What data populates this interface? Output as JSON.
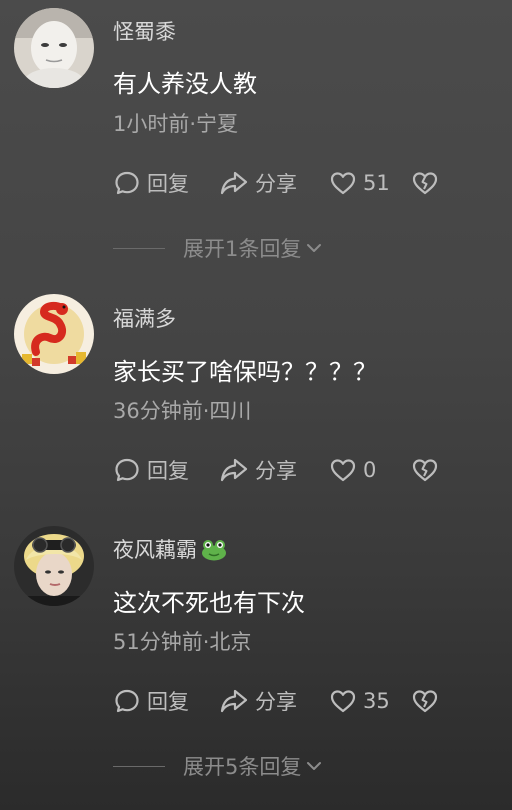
{
  "comments": [
    {
      "username": "怪蜀黍",
      "text": "有人养没人教",
      "meta": "1小时前·宁夏",
      "reply_label": "回复",
      "share_label": "分享",
      "likes": "51",
      "expand_label": "展开1条回复"
    },
    {
      "username": "福满多",
      "text": "家长买了啥保吗？？？？",
      "meta": "36分钟前·四川",
      "reply_label": "回复",
      "share_label": "分享",
      "likes": "0"
    },
    {
      "username": "夜风藕霸",
      "text": "这次不死也有下次",
      "meta": "51分钟前·北京",
      "reply_label": "回复",
      "share_label": "分享",
      "likes": "35",
      "expand_label": "展开5条回复"
    }
  ],
  "icons": {
    "reply": "chat-bubble-icon",
    "share": "share-arrow-icon",
    "like": "heart-icon",
    "dislike": "broken-heart-icon",
    "expand": "chevron-down-icon",
    "badge": "frog-emoji-icon"
  },
  "colors": {
    "background": "#474747",
    "text_primary": "#ffffff",
    "text_secondary": "#a8a8a8",
    "action": "#bdbdbd"
  }
}
